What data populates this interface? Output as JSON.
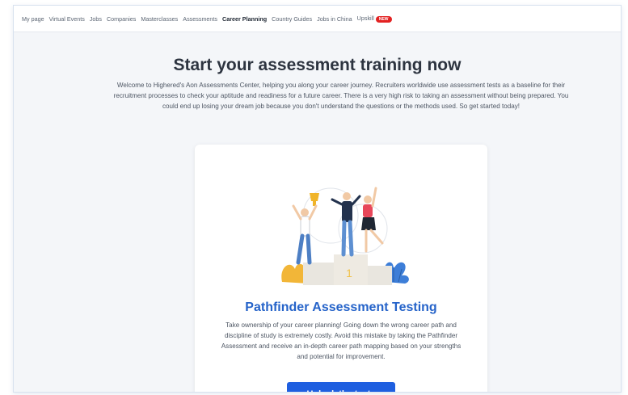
{
  "nav": {
    "items": [
      {
        "label": "My page"
      },
      {
        "label": "Virtual Events"
      },
      {
        "label": "Jobs"
      },
      {
        "label": "Companies"
      },
      {
        "label": "Masterclasses"
      },
      {
        "label": "Assessments"
      },
      {
        "label": "Career Planning",
        "active": true
      },
      {
        "label": "Country Guides"
      },
      {
        "label": "Jobs in China"
      },
      {
        "label": "Upskill"
      }
    ],
    "badge": "NEW"
  },
  "hero": {
    "title": "Start your assessment training now",
    "intro": "Welcome to Highered's Aon Assessments Center, helping you along your career journey. Recruiters worldwide use assessment tests as a baseline for their recruitment processes to check your aptitude and readiness for a future career. There is a very high risk to taking an assessment without being prepared. You could end up losing your dream job because you don't understand the questions or the methods used. So get started today!"
  },
  "card": {
    "illustration": "winners-podium-illustration",
    "title": "Pathfinder Assessment Testing",
    "text": "Take ownership of your career planning! Going down the wrong career path and discipline of study is extremely costly. Avoid this mistake by taking the Pathfinder Assessment and receive an in-depth career path mapping based on your strengths and potential for improvement.",
    "button_label": "Unlock the tests",
    "podium_label": "1"
  },
  "colors": {
    "accent": "#2563c9",
    "button": "#1f5fe0",
    "badge": "#e32222"
  }
}
